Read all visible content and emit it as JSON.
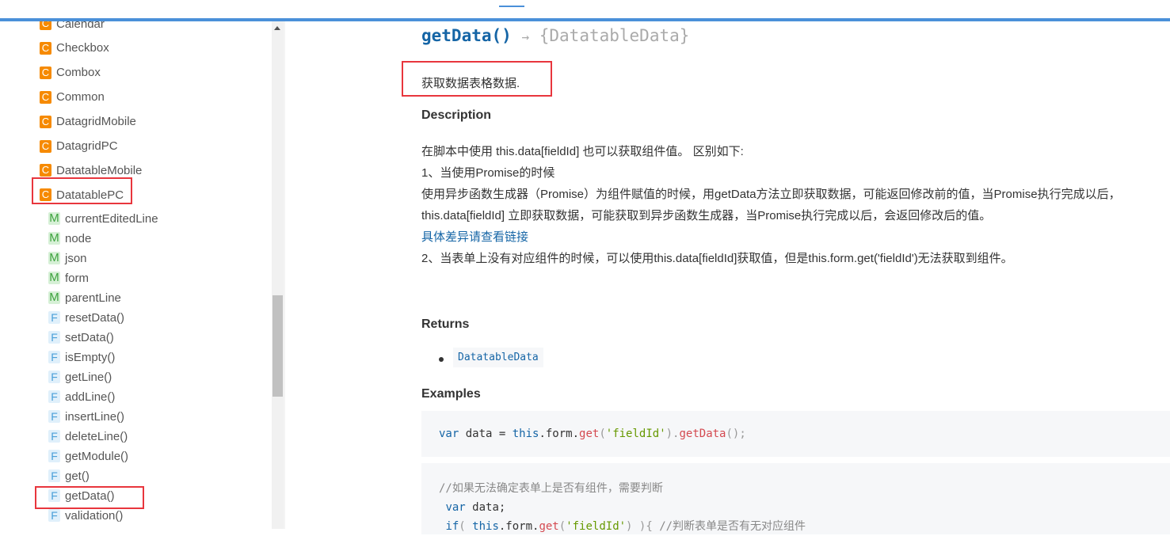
{
  "sidebar": {
    "classes": [
      {
        "icon": "C",
        "label": "Calendar"
      },
      {
        "icon": "C",
        "label": "Checkbox"
      },
      {
        "icon": "C",
        "label": "Combox"
      },
      {
        "icon": "C",
        "label": "Common"
      },
      {
        "icon": "C",
        "label": "DatagridMobile"
      },
      {
        "icon": "C",
        "label": "DatagridPC"
      },
      {
        "icon": "C",
        "label": "DatatableMobile"
      },
      {
        "icon": "C",
        "label": "DatatablePC"
      }
    ],
    "members": [
      {
        "icon": "M",
        "label": "currentEditedLine"
      },
      {
        "icon": "M",
        "label": "node"
      },
      {
        "icon": "M",
        "label": "json"
      },
      {
        "icon": "M",
        "label": "form"
      },
      {
        "icon": "M",
        "label": "parentLine"
      },
      {
        "icon": "F",
        "label": "resetData()"
      },
      {
        "icon": "F",
        "label": "setData()"
      },
      {
        "icon": "F",
        "label": "isEmpty()"
      },
      {
        "icon": "F",
        "label": "getLine()"
      },
      {
        "icon": "F",
        "label": "addLine()"
      },
      {
        "icon": "F",
        "label": "insertLine()"
      },
      {
        "icon": "F",
        "label": "deleteLine()"
      },
      {
        "icon": "F",
        "label": "getModule()"
      },
      {
        "icon": "F",
        "label": "get()"
      },
      {
        "icon": "F",
        "label": "getData()"
      },
      {
        "icon": "F",
        "label": "validation()"
      }
    ]
  },
  "method": {
    "name": "getData()",
    "arrow": "→",
    "returns": "{DatatableData}",
    "summary": "获取数据表格数据.",
    "description_heading": "Description",
    "description_lines": [
      "在脚本中使用 this.data[fieldId] 也可以获取组件值。 区别如下:",
      "1、当使用Promise的时候",
      "使用异步函数生成器（Promise）为组件赋值的时候，用getData方法立即获取数据，可能返回修改前的值，当Promise执行完成以后，",
      "this.data[fieldId] 立即获取数据，可能获取到异步函数生成器，当Promise执行完成以后，会返回修改后的值。",
      "具体差异请查看链接",
      "2、当表单上没有对应组件的时候，可以使用this.data[fieldId]获取值，但是this.form.get('fieldId')无法获取到组件。"
    ],
    "returns_heading": "Returns",
    "return_type": "DatatableData",
    "examples_heading": "Examples",
    "example1": {
      "kw": "var",
      "rest1": " data = ",
      "this": "this",
      ".form.": ".form.",
      "get": "get",
      "p1": "(",
      "str": "'fieldId'",
      "p2": ").",
      "getData": "getData",
      "end": "();"
    },
    "example2": {
      "comment": "//如果无法确定表单上是否有组件，需要判断",
      "line2_kw": "var",
      "line2_rest": " data;",
      "line3_if": "if",
      "line3_a": "( ",
      "line3_this": "this",
      "line3_form": ".form.",
      "line3_get": "get",
      "line3_p": "(",
      "line3_str": "'fieldId'",
      "line3_close": ") ){ ",
      "line3_comment": "//判断表单是否有无对应组件"
    }
  },
  "colors": {
    "accent": "#4a90d9",
    "highlight": "#e8363d",
    "class_icon": "#f68a00",
    "link": "#1565a6"
  }
}
